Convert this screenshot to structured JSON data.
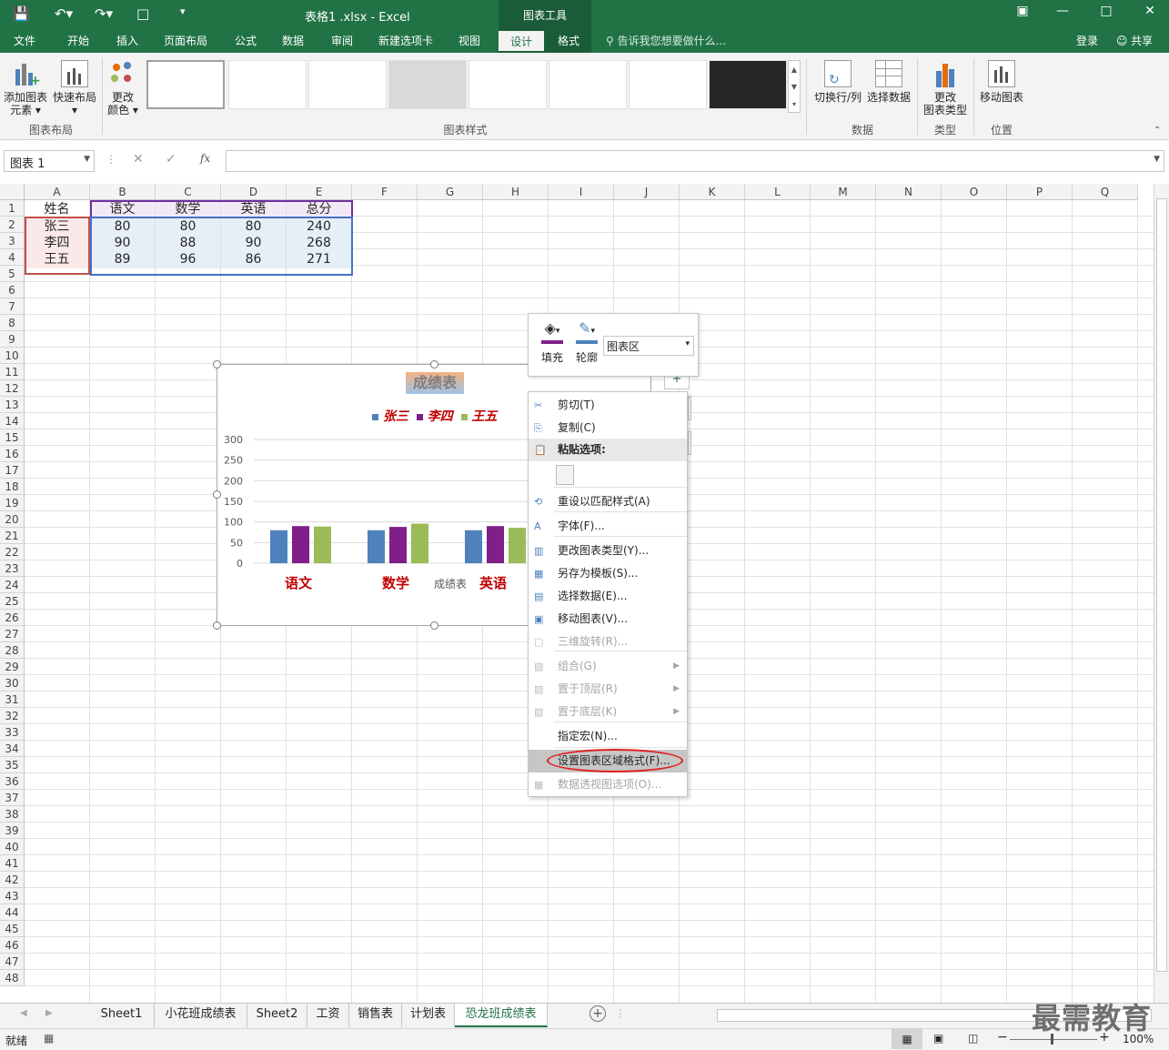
{
  "title_bar": {
    "document_title": "表格1 .xlsx - Excel",
    "context_group": "图表工具",
    "login": "登录",
    "share": "共享"
  },
  "tabs": [
    "文件",
    "开始",
    "插入",
    "页面布局",
    "公式",
    "数据",
    "审阅",
    "新建选项卡",
    "视图",
    "设计",
    "格式"
  ],
  "active_tab": "设计",
  "tell_me": "告诉我您想要做什么...",
  "ribbon": {
    "add_element_1": "添加图表",
    "add_element_2": "元素",
    "quick_layout": "快速布局",
    "change_colors_1": "更改",
    "change_colors_2": "颜色",
    "group_layout": "图表布局",
    "group_styles": "图表样式",
    "switch_row_col": "切换行/列",
    "select_data": "选择数据",
    "group_data": "数据",
    "change_type_1": "更改",
    "change_type_2": "图表类型",
    "group_type": "类型",
    "move_chart": "移动图表",
    "group_location": "位置"
  },
  "formula_bar": {
    "name_box": "图表 1",
    "fx": "fx",
    "content": ""
  },
  "columns": [
    "A",
    "B",
    "C",
    "D",
    "E",
    "F",
    "G",
    "H",
    "I",
    "J",
    "K",
    "L",
    "M",
    "N",
    "O",
    "P",
    "Q"
  ],
  "rows": [
    "1",
    "2",
    "3",
    "4",
    "5",
    "6",
    "7",
    "8",
    "9",
    "10",
    "11",
    "12",
    "13",
    "14",
    "15",
    "16",
    "17",
    "18",
    "19",
    "20",
    "21",
    "22",
    "23",
    "24",
    "25",
    "26",
    "27",
    "28",
    "29",
    "30",
    "31",
    "32",
    "33",
    "34",
    "35",
    "36",
    "37",
    "38",
    "39",
    "40",
    "41",
    "42",
    "43",
    "44",
    "45",
    "46",
    "47",
    "48"
  ],
  "table": {
    "headers": [
      "姓名",
      "语文",
      "数学",
      "英语",
      "总分"
    ],
    "rows": [
      [
        "张三",
        "80",
        "80",
        "80",
        "240"
      ],
      [
        "李四",
        "90",
        "88",
        "90",
        "268"
      ],
      [
        "王五",
        "89",
        "96",
        "86",
        "271"
      ]
    ]
  },
  "chart": {
    "title": "成绩表",
    "axis_title": "成绩表",
    "legend": [
      "张三",
      "李四",
      "王五"
    ],
    "series_colors": [
      "#4f81bd",
      "#7f1f8a",
      "#9bbb59"
    ],
    "y_ticks": [
      "300",
      "250",
      "200",
      "150",
      "100",
      "50",
      "0"
    ]
  },
  "chart_data": {
    "type": "bar",
    "title": "成绩表",
    "categories": [
      "语文",
      "数学",
      "英语"
    ],
    "series": [
      {
        "name": "张三",
        "values": [
          80,
          80,
          80
        ]
      },
      {
        "name": "李四",
        "values": [
          90,
          88,
          90
        ]
      },
      {
        "name": "王五",
        "values": [
          89,
          96,
          86
        ]
      }
    ],
    "ylim": [
      0,
      300
    ],
    "legend": "top"
  },
  "mini_toolbar": {
    "fill": "填充",
    "outline": "轮廓",
    "element_select": "图表区"
  },
  "context_menu": [
    {
      "label": "剪切(T)",
      "disabled": false,
      "icon": "scissors-icon"
    },
    {
      "label": "复制(C)",
      "disabled": false,
      "icon": "copy-icon"
    },
    {
      "label": "粘贴选项:",
      "disabled": false,
      "icon": "paste-icon"
    },
    {
      "label": "重设以匹配样式(A)",
      "disabled": false,
      "icon": "reset-style-icon"
    },
    {
      "label": "字体(F)...",
      "disabled": false,
      "icon": "font-icon"
    },
    {
      "label": "更改图表类型(Y)...",
      "disabled": false,
      "icon": "chart-type-icon"
    },
    {
      "label": "另存为模板(S)...",
      "disabled": false,
      "icon": "save-template-icon"
    },
    {
      "label": "选择数据(E)...",
      "disabled": false,
      "icon": "select-data-icon"
    },
    {
      "label": "移动图表(V)...",
      "disabled": false,
      "icon": "move-chart-icon"
    },
    {
      "label": "三维旋转(R)...",
      "disabled": true,
      "icon": "rotate-3d-icon"
    },
    {
      "label": "组合(G)",
      "disabled": true,
      "icon": "group-icon"
    },
    {
      "label": "置于顶层(R)",
      "disabled": true,
      "icon": "bring-front-icon"
    },
    {
      "label": "置于底层(K)",
      "disabled": true,
      "icon": "send-back-icon"
    },
    {
      "label": "指定宏(N)...",
      "disabled": false,
      "icon": "macro-icon"
    },
    {
      "label": "设置图表区域格式(F)...",
      "disabled": false,
      "icon": "format-area-icon"
    },
    {
      "label": "数据透视图选项(O)...",
      "disabled": true,
      "icon": "pivot-options-icon"
    }
  ],
  "sheets": [
    "Sheet1",
    "小花班成绩表",
    "Sheet2",
    "工资",
    "销售表",
    "计划表",
    "恐龙班成绩表"
  ],
  "active_sheet": "恐龙班成绩表",
  "status": {
    "ready": "就绪",
    "zoom": "100%"
  },
  "watermark": "最需教育"
}
